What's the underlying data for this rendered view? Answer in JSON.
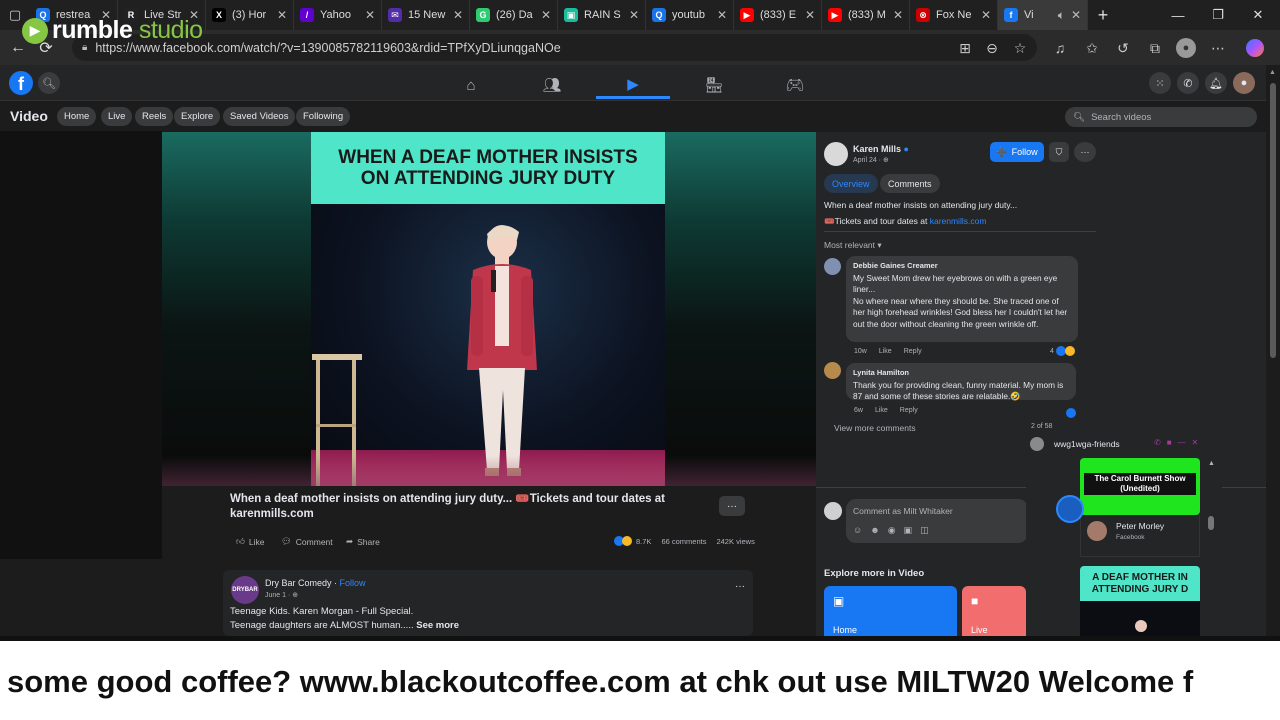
{
  "browser": {
    "tabs": [
      {
        "title": "restrea",
        "color": "#1a73e8",
        "glyph": "Q"
      },
      {
        "title": "Live Str",
        "color": "#222",
        "glyph": "R"
      },
      {
        "title": "(3) Hor",
        "color": "#000",
        "glyph": "X"
      },
      {
        "title": "Yahoo",
        "color": "#6001d2",
        "glyph": "/"
      },
      {
        "title": "15 New",
        "color": "#512da8",
        "glyph": "✉"
      },
      {
        "title": "(26) Da",
        "color": "#2ecc71",
        "glyph": "G"
      },
      {
        "title": "RAIN S",
        "color": "#1abc9c",
        "glyph": "▣"
      },
      {
        "title": "youtub",
        "color": "#1a73e8",
        "glyph": "Q"
      },
      {
        "title": "(833) E",
        "color": "#ff0000",
        "glyph": "▶"
      },
      {
        "title": "(833) M",
        "color": "#ff0000",
        "glyph": "▶"
      },
      {
        "title": "Fox Ne",
        "color": "#cc0000",
        "glyph": "⊗"
      },
      {
        "title": "Vi",
        "color": "#1877f2",
        "glyph": "f"
      }
    ],
    "url": "https://www.facebook.com/watch/?v=1390085782119603&rdid=TPfXyDLiunqgaNOe"
  },
  "watermark": {
    "brand": "rumble",
    "product": "studio"
  },
  "fb": {
    "section_title": "Video",
    "nav_pills": [
      "Home",
      "Live",
      "Reels",
      "Explore",
      "Saved Videos",
      "Following"
    ],
    "search_placeholder": "Search videos"
  },
  "video": {
    "banner_line1": "WHEN A DEAF MOTHER INSISTS",
    "banner_line2": "ON ATTENDING JURY DUTY",
    "caption": "When a deaf mother insists on attending jury duty... 🎟️Tickets and tour dates at karenmills.com",
    "actions": {
      "like": "Like",
      "comment": "Comment",
      "share": "Share"
    },
    "reaction_count": "8.7K",
    "comments_count": "66 comments",
    "views": "242K views"
  },
  "feed_post": {
    "page_name": "Dry Bar Comedy",
    "follow": "Follow",
    "date": "June 1 · ",
    "title": "Teenage Kids. Karen Morgan - Full Special.",
    "body": "Teenage daughters are ALMOST human.....",
    "see_more": "See more",
    "logo_text": "DRYBAR"
  },
  "panel": {
    "author": "Karen Mills",
    "date": "April 24 · ",
    "follow": "Follow",
    "tabs": [
      "Overview",
      "Comments"
    ],
    "desc_line1": "When a deaf mother insists on attending jury duty...",
    "desc_line2_prefix": "🎟️Tickets and tour dates at ",
    "desc_link": "karenmills.com",
    "sort": "Most relevant",
    "comments": [
      {
        "name": "Debbie Gaines Creamer",
        "text": "My Sweet Mom drew her eyebrows on with a green eye liner...\nNo where near where they should be. She traced one of her high forehead wrinkles! God bless her I couldn't let her out the door without cleaning the green wrinkle off.",
        "age": "10w",
        "like": "Like",
        "reply": "Reply",
        "reacts": "4"
      },
      {
        "name": "Lynita Hamilton",
        "text": "Thank you for providing clean, funny material. My mom is 87 and some of these stories are relatable.🤣",
        "age": "6w",
        "like": "Like",
        "reply": "Reply",
        "reacts": ""
      }
    ],
    "pager": "2 of 58",
    "view_more": "View more comments",
    "comment_placeholder": "Comment as Milt Whitaker",
    "explore_title": "Explore more in Video",
    "explore_cards": [
      "Home",
      "Live"
    ]
  },
  "chat": {
    "title": "wwg1wga-friends",
    "thumb1_text": "The Carol Burnett Show (Unedited)",
    "member_name": "Peter Morley",
    "member_sub": "Facebook",
    "thumb2_line1": "A DEAF MOTHER IN",
    "thumb2_line2": "ATTENDING JURY D"
  },
  "ticker": {
    "text": "some good coffee? www.blackoutcoffee.com at chk out use MILTW20  Welcome f"
  },
  "colors": {
    "fb_blue": "#1877f2",
    "banner_teal": "#4ee5c8",
    "green_thumb": "#1ee51e",
    "rumble_green": "#85c742"
  }
}
